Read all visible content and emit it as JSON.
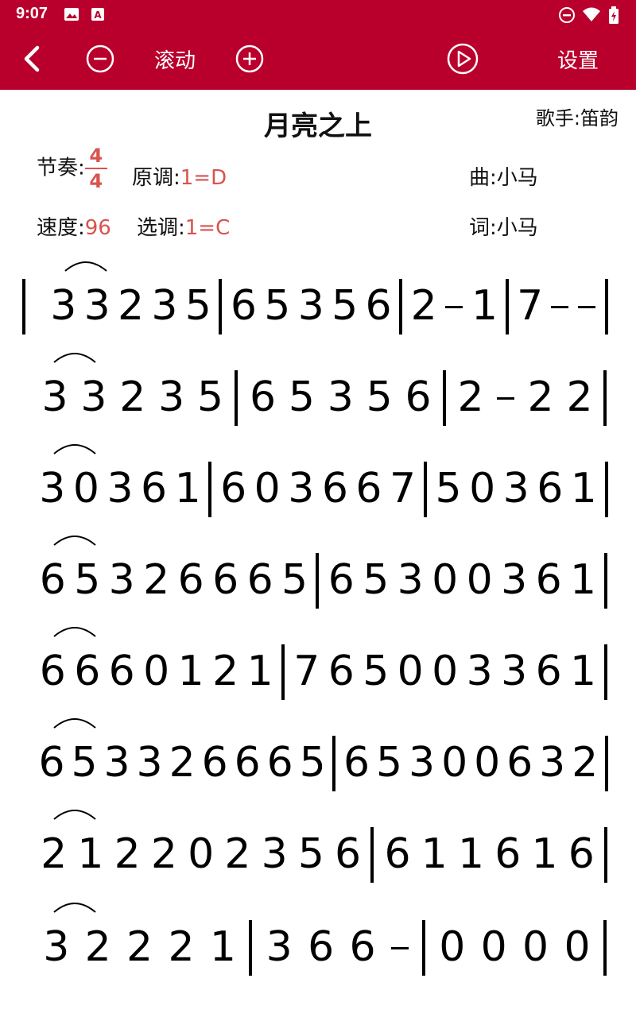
{
  "status": {
    "time": "9:07",
    "icons": [
      "image-icon",
      "a-badge-icon",
      "dnd-icon",
      "wifi-icon",
      "battery-icon"
    ]
  },
  "toolbar": {
    "scroll_label": "滚动",
    "settings_label": "设置",
    "icons": [
      "back-arrow-icon",
      "minus-circle-icon",
      "plus-circle-icon",
      "play-circle-icon"
    ]
  },
  "sheet": {
    "title": "月亮之上",
    "singer": "歌手:笛韵",
    "rhythm_label": "节奏:",
    "rhythm_top": "4",
    "rhythm_bottom": "4",
    "orig_key_label": "原调:",
    "orig_key_value": "1=D",
    "tempo_label": "速度:",
    "tempo_value": "96",
    "sel_key_label": "选调:",
    "sel_key_value": "1=C",
    "composer": "曲:小马",
    "lyricist": "词:小马"
  },
  "colors": {
    "topbar": "#b9002c",
    "accent": "#d9534f"
  },
  "notation_rows": [
    [
      "3",
      "3",
      "2",
      "3",
      "5",
      "|",
      "6",
      "5",
      "3",
      "5",
      "6",
      "|",
      "2",
      "-",
      "1",
      "|",
      "7",
      "-",
      "-",
      "|"
    ],
    [
      "3",
      "3",
      "2",
      "3",
      "5",
      "|",
      "6",
      "5",
      "3",
      "5",
      "6",
      "|",
      "2",
      "-",
      "2",
      "2",
      "|"
    ],
    [
      "3",
      "0",
      "3",
      "6",
      "1",
      "|",
      "6",
      "0",
      "3",
      "6",
      "6",
      "7",
      "|",
      "5",
      "0",
      "3",
      "6",
      "1",
      "|"
    ],
    [
      "6",
      "5",
      "3",
      "2",
      "6",
      "6",
      "6",
      "5",
      "|",
      "6",
      "5",
      "3",
      "0",
      "0",
      "3",
      "6",
      "1",
      "|"
    ],
    [
      "6",
      "6",
      "6",
      "0",
      "1",
      "2",
      "1",
      "|",
      "7",
      "6",
      "5",
      "0",
      "0",
      "3",
      "3",
      "6",
      "1",
      "|"
    ],
    [
      "6",
      "5",
      "3",
      "3",
      "2",
      "6",
      "6",
      "6",
      "5",
      "|",
      "6",
      "5",
      "3",
      "0",
      "0",
      "6",
      "3",
      "2",
      "|"
    ],
    [
      "2",
      "1",
      "2",
      "2",
      "0",
      "2",
      "3",
      "5",
      "6",
      "|",
      "6",
      "1",
      "1",
      "6",
      "1",
      "6",
      "|"
    ],
    [
      "3",
      "2",
      "2",
      "2",
      "1",
      "|",
      "3",
      "6",
      "6",
      "-",
      "|",
      "0",
      "0",
      "0",
      "0",
      "|"
    ]
  ]
}
